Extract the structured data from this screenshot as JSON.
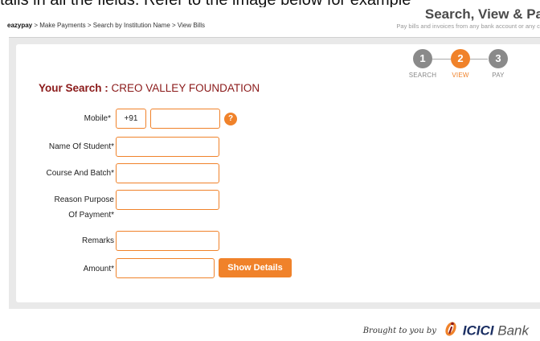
{
  "top_crop_text": "tails in all the fields. Refer to the image below for example",
  "breadcrumb": {
    "root": "eazypay",
    "path": " > Make Payments > Search by Institution Name > View Bills"
  },
  "header": {
    "title": "Search, View & Pa",
    "subtitle": "Pay bills and invoices from any bank account or any ca"
  },
  "steps": [
    {
      "number": "1",
      "label": "SEARCH",
      "active": false
    },
    {
      "number": "2",
      "label": "VIEW",
      "active": true
    },
    {
      "number": "3",
      "label": "PAY",
      "active": false
    }
  ],
  "search": {
    "label": "Your Search :",
    "value": " CREO VALLEY FOUNDATION"
  },
  "form": {
    "mobile_label": "Mobile*",
    "mobile_prefix": "+91",
    "mobile_value": "",
    "help_glyph": "?",
    "student_label": "Name Of Student*",
    "student_value": "",
    "course_label": "Course And Batch*",
    "course_value": "",
    "reason_label_1": "Reason Purpose",
    "reason_label_2": "Of Payment*",
    "reason_value": "",
    "remarks_label": "Remarks",
    "remarks_value": "",
    "amount_label": "Amount*",
    "amount_value": "",
    "show_details": "Show Details"
  },
  "footer": {
    "brought_by": "Brought to you by",
    "bank_name": "ICICI",
    "bank_word": " Bank"
  },
  "colors": {
    "accent": "#f0822a",
    "title_red": "#8b1a1a",
    "step_gray": "#8a8a8a",
    "bank_blue": "#1b2f63"
  },
  "icons": {
    "help": "question-circle-icon",
    "bank_logo": "icici-logo-icon"
  }
}
